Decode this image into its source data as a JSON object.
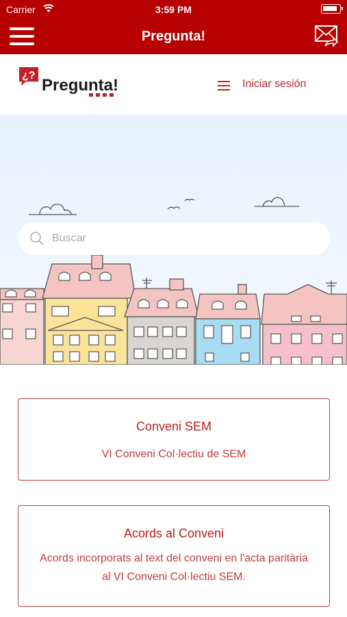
{
  "status_bar": {
    "carrier": "Carrier",
    "time": "3:59 PM"
  },
  "nav_bar": {
    "title": "Pregunta!"
  },
  "site_header": {
    "logo_text": "Pregunta!",
    "logo_mark": "¿?",
    "login_label": "Iniciar sesión"
  },
  "search": {
    "placeholder": "Buscar"
  },
  "cards": [
    {
      "title": "Conveni SEM",
      "description": "VI Conveni Col·lectiu de SEM"
    },
    {
      "title": "Acords al Conveni",
      "description": "Acords incorporats al text del conveni en l'acta paritària al VI Conveni Col·lectiu SEM."
    }
  ],
  "colors": {
    "brand_red": "#b70000",
    "accent_red": "#c0202a",
    "hero_sky": "#e8f1fb"
  }
}
